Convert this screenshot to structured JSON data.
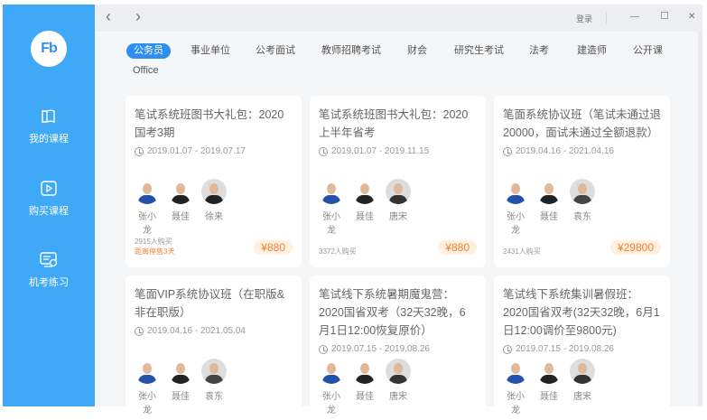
{
  "sidebar": {
    "logo": "Fb",
    "items": [
      {
        "label": "我的课程",
        "icon": "book-icon"
      },
      {
        "label": "购买课程",
        "icon": "play-icon"
      },
      {
        "label": "机考练习",
        "icon": "computer-clock-icon"
      }
    ]
  },
  "topbar": {
    "back": "‹",
    "forward": "›",
    "login": "登录",
    "minimize": "—",
    "maximize": "☐",
    "close": "✕"
  },
  "tabs": [
    "公务员",
    "事业单位",
    "公考面试",
    "教师招聘考试",
    "财会",
    "研究生考试",
    "法考",
    "建造师",
    "公开课",
    "Office"
  ],
  "active_tab": "公务员",
  "colors": {
    "sidebar": "#40a9f7",
    "accent": "#2f8ff0",
    "price": "#f5812f"
  },
  "courses": [
    {
      "title": "笔试系统班图书大礼包：2020国考3期",
      "date": "2019.01.07 - 2019.07.17",
      "teachers": [
        "张小龙",
        "聂佳",
        "徐来"
      ],
      "buyers": "2915人购买",
      "notice": "距离停售3天",
      "price": "¥880"
    },
    {
      "title": "笔试系统班图书大礼包：2020上半年省考",
      "date": "2019.01.07 - 2019.11.15",
      "teachers": [
        "张小龙",
        "聂佳",
        "唐宋"
      ],
      "buyers": "3372人购买",
      "price": "¥880"
    },
    {
      "title": "笔面系统协议班（笔试未通过退20000，面试未通过全额退款）",
      "date": "2019.04.16 - 2021.04.16",
      "teachers": [
        "张小龙",
        "聂佳",
        "袁东"
      ],
      "buyers": "2431人购买",
      "price": "¥29800"
    },
    {
      "title": "笔面VIP系统协议班（在职版&非在职版）",
      "date": "2019.04.16 - 2021.05.04",
      "teachers": [
        "张小龙",
        "聂佳",
        "袁东"
      ]
    },
    {
      "title": "笔试线下系统暑期魔鬼营：2020国省双考（32天32晚，6月1日12:00恢复原价）",
      "date": "2019.07.15 - 2019.08.26",
      "teachers": [
        "张小龙",
        "聂佳",
        "唐宋"
      ]
    },
    {
      "title": "笔试线下系统集训暑假班：2020国省双考(32天32晚，6月1日12:00调价至9800元)",
      "date": "2019.07.15 - 2019.08.26",
      "teachers": [
        "张小龙",
        "聂佳",
        "唐宋"
      ]
    }
  ]
}
